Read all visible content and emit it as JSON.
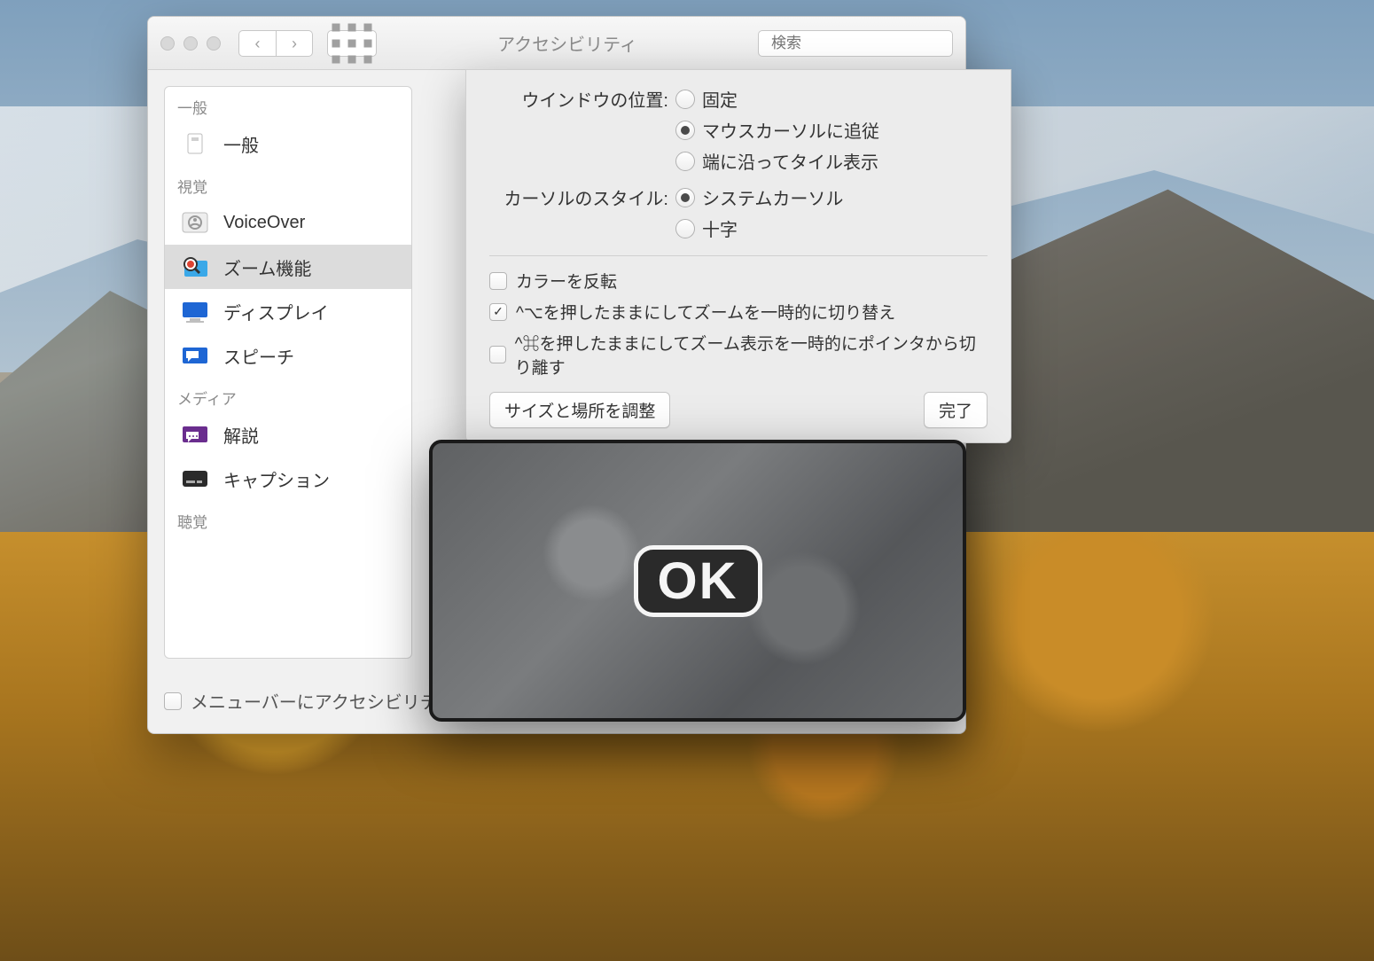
{
  "window": {
    "title": "アクセシビリティ",
    "search_placeholder": "検索"
  },
  "sidebar": {
    "categories": [
      {
        "label": "一般",
        "items": [
          {
            "key": "general",
            "label": "一般"
          }
        ]
      },
      {
        "label": "視覚",
        "items": [
          {
            "key": "voiceover",
            "label": "VoiceOver"
          },
          {
            "key": "zoom",
            "label": "ズーム機能",
            "selected": true
          },
          {
            "key": "display",
            "label": "ディスプレイ"
          },
          {
            "key": "speech",
            "label": "スピーチ"
          }
        ]
      },
      {
        "label": "メディア",
        "items": [
          {
            "key": "descriptions",
            "label": "解説"
          },
          {
            "key": "captions",
            "label": "キャプション"
          }
        ]
      },
      {
        "label": "聴覚",
        "items": []
      }
    ]
  },
  "footer": {
    "menubar_checkbox_label": "メニューバーにアクセシビリティの",
    "help_symbol": "?"
  },
  "sheet": {
    "window_position_label": "ウインドウの位置:",
    "window_position_options": [
      {
        "label": "固定",
        "selected": false
      },
      {
        "label": "マウスカーソルに追従",
        "selected": true
      },
      {
        "label": "端に沿ってタイル表示",
        "selected": false
      }
    ],
    "cursor_style_label": "カーソルのスタイル:",
    "cursor_style_options": [
      {
        "label": "システムカーソル",
        "selected": true
      },
      {
        "label": "十字",
        "selected": false
      }
    ],
    "checkboxes": [
      {
        "label": "カラーを反転",
        "checked": false
      },
      {
        "label": "^⌥を押したままにしてズームを一時的に切り替え",
        "checked": true
      },
      {
        "label": "^⌘を押したままにしてズーム表示を一時的にポインタから切り離す",
        "checked": false
      }
    ],
    "adjust_button": "サイズと場所を調整",
    "done_button": "完了"
  },
  "zoom_overlay": {
    "ok_label": "OK"
  }
}
